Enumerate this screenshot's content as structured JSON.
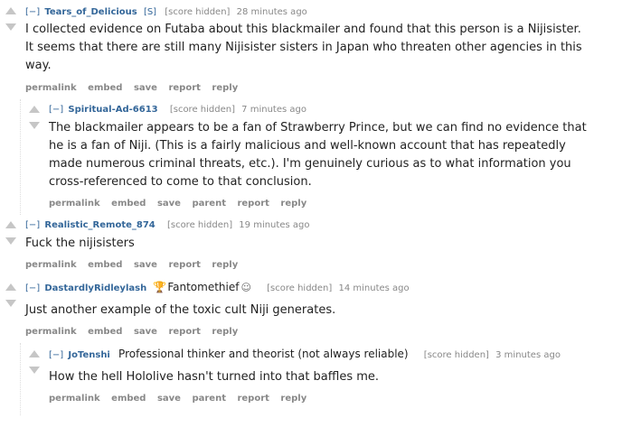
{
  "comments": [
    {
      "toggle": "[−]",
      "author": "Tears_of_Delicious",
      "flag": "[S]",
      "score": "[score hidden]",
      "time": "28 minutes ago",
      "lines": [
        "I collected evidence on Futaba about this blackmailer and found that this person is a Nijisister.",
        "It seems that there are still many Nijisister sisters in Japan who threaten other agencies in this",
        "way."
      ],
      "buttons": [
        "permalink",
        "embed",
        "save",
        "report",
        "reply"
      ]
    },
    {
      "toggle": "[−]",
      "author": "Spiritual-Ad-6613",
      "score": "[score hidden]",
      "time": "7 minutes ago",
      "lines": [
        "The blackmailer appears to be a fan of Strawberry Prince, but we can find no evidence that",
        "he is a fan of Niji. (This is a fairly malicious and well-known account that has repeatedly",
        "made numerous criminal threats, etc.). I'm genuinely curious as to what information you",
        "cross-referenced to come to that conclusion."
      ],
      "buttons": [
        "permalink",
        "embed",
        "save",
        "parent",
        "report",
        "reply"
      ]
    },
    {
      "toggle": "[−]",
      "author": "Realistic_Remote_874",
      "score": "[score hidden]",
      "time": "19 minutes ago",
      "lines": [
        "Fuck the nijisisters"
      ],
      "buttons": [
        "permalink",
        "embed",
        "save",
        "report",
        "reply"
      ]
    },
    {
      "toggle": "[−]",
      "author": "DastardlyRidleylash",
      "flair": "Fantomethief",
      "score": "[score hidden]",
      "time": "14 minutes ago",
      "lines": [
        "Just another example of the toxic cult Niji generates."
      ],
      "buttons": [
        "permalink",
        "embed",
        "save",
        "report",
        "reply"
      ]
    },
    {
      "toggle": "[−]",
      "author": "JoTenshi",
      "flair": "Professional thinker and theorist (not always reliable)",
      "score": "[score hidden]",
      "time": "3 minutes ago",
      "lines": [
        "How the hell Hololive hasn't turned into that baffles me."
      ],
      "buttons": [
        "permalink",
        "embed",
        "save",
        "parent",
        "report",
        "reply"
      ]
    }
  ]
}
